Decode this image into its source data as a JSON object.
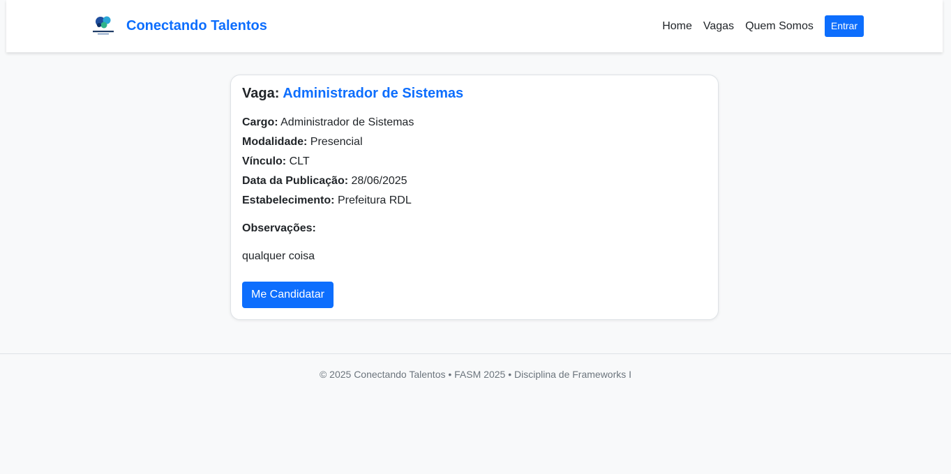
{
  "header": {
    "brand_name": "Conectando Talentos",
    "logo_icon": "conectando-talentos-logo",
    "nav": {
      "home": "Home",
      "vagas": "Vagas",
      "quem_somos": "Quem Somos"
    },
    "login_label": "Entrar"
  },
  "job": {
    "title_prefix": "Vaga:",
    "title_value": "Administrador de Sistemas",
    "fields": {
      "cargo": {
        "label": "Cargo:",
        "value": "Administrador de Sistemas"
      },
      "modalidade": {
        "label": "Modalidade:",
        "value": "Presencial"
      },
      "vinculo": {
        "label": "Vínculo:",
        "value": "CLT"
      },
      "data_publicacao": {
        "label": "Data da Publicação:",
        "value": "28/06/2025"
      },
      "estabelecimento": {
        "label": "Estabelecimento:",
        "value": "Prefeitura RDL"
      }
    },
    "observacoes_label": "Observações:",
    "observacoes_text": "qualquer coisa",
    "apply_label": "Me Candidatar"
  },
  "footer": {
    "text": "© 2025 Conectando Talentos • FASM 2025 • Disciplina de Frameworks I"
  },
  "colors": {
    "primary": "#0d6efd",
    "page_background": "#f8f9fa",
    "card_background": "#ffffff",
    "text": "#212529",
    "muted_text": "#6c757d"
  }
}
